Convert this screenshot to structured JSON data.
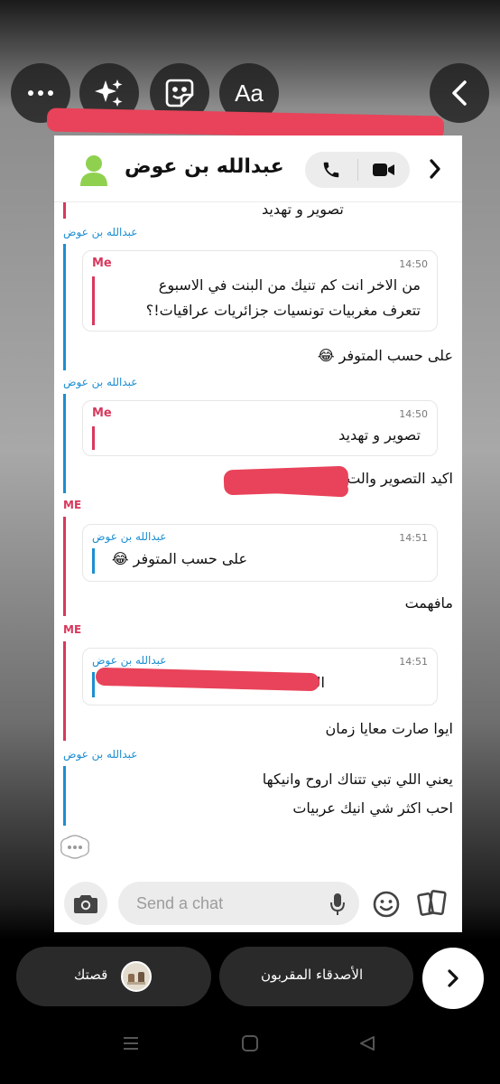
{
  "top_toolbar": {
    "more_icon": "more-icon",
    "sparkle_icon": "sparkle-icon",
    "sticker_icon": "sticker-icon",
    "text_tool_label": "Aa",
    "back_icon": "chevron-left-icon"
  },
  "chat": {
    "contact_name": "عبدالله بن عوض",
    "partial_top_text": "تصوير و تهديد",
    "messages": [
      {
        "sender": "عبدالله بن عوض",
        "quote": {
          "name": "Me",
          "time": "14:50",
          "lines": [
            "من الاخر انت كم تنيك من البنت في الاسبوع",
            "تتعرف مغربيات تونسيات جزائريات عراقيات!؟"
          ]
        },
        "text": "على حسب المتوفر 😂"
      },
      {
        "sender": "عبدالله بن عوض",
        "quote": {
          "name": "Me",
          "time": "14:50",
          "lines": [
            "تصوير و تهديد"
          ]
        },
        "text": "اكيد التصوير والت"
      },
      {
        "sender": "ME",
        "quote": {
          "name": "عبدالله بن عوض",
          "time": "14:51",
          "lines": [
            "على حسب المتوفر 😂"
          ]
        },
        "text": "مافهمت"
      },
      {
        "sender": "ME",
        "quote": {
          "name": "عبدالله بن عوض",
          "time": "14:51",
          "lines": [
            "اك"
          ]
        },
        "text": "ايوا صارت معايا زمان"
      },
      {
        "sender": "عبدالله بن عوض",
        "lines": [
          "يعني اللي تبي تتناك اروح وانيكها",
          "احب اكثر شي انيك عربيات"
        ]
      }
    ],
    "input_placeholder": "Send a chat"
  },
  "footer": {
    "story_label": "قصتك",
    "close_friends_label": "الأصدقاء المقربون"
  },
  "colors": {
    "me_accent": "#d8385d",
    "friend_accent": "#1c8ed1",
    "avatar_green": "#8fd14f",
    "redaction": "#e8435a"
  }
}
